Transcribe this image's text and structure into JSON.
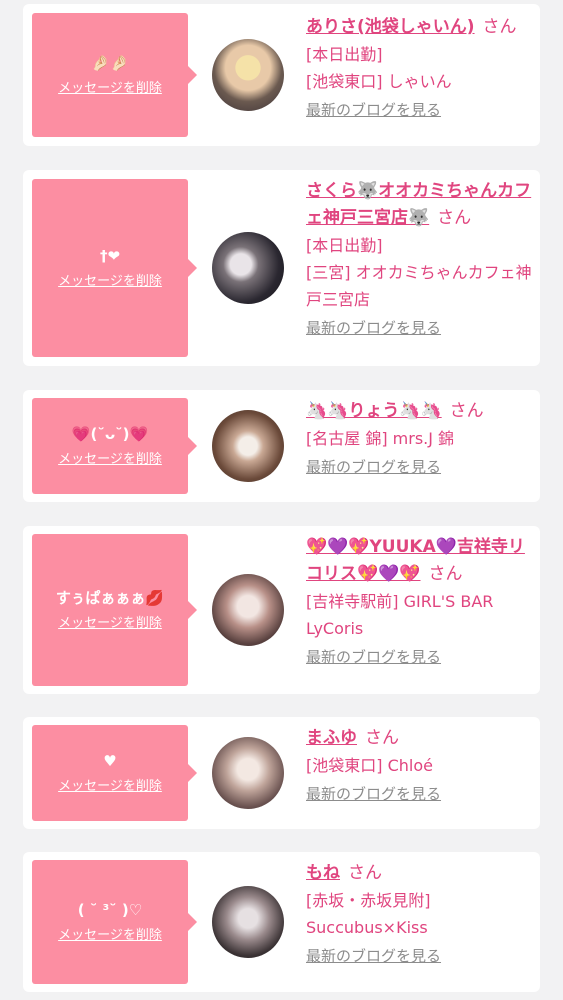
{
  "common": {
    "delete_label": "メッセージを削除",
    "blog_label": "最新のブログを見る",
    "san_label": "さん"
  },
  "cards": [
    {
      "message": "🤌🏻🤌🏻",
      "name": "ありさ(池袋しゃいん)",
      "detail1": "[本日出勤]",
      "detail2": "[池袋東口] しゃいん"
    },
    {
      "message": "†❤",
      "name": "さくら🐺オオカミちゃんカフェ神戸三宮店🐺",
      "detail1": "[本日出勤]",
      "detail2": "[三宮] オオカミちゃんカフェ神戸三宮店"
    },
    {
      "message": "💗(˘ᴗ˘)💗",
      "name": "🦄🦄りょう🦄🦄",
      "detail1": "[名古屋 錦] mrs.J 錦"
    },
    {
      "message": "すぅぱぁぁぁ💋",
      "name": "💖💜💖YUUKA💜吉祥寺リコリス💖💜💖",
      "detail1": "[吉祥寺駅前] GIRL'S BAR LyCoris"
    },
    {
      "message": "♥",
      "name": "まふゆ",
      "detail1": "[池袋東口] Chloé"
    },
    {
      "message": "( ˘ ³˘ )♡",
      "name": "もね",
      "detail1": "[赤坂・赤坂見附] Succubus×Kiss"
    }
  ],
  "colors": {
    "accent": "#e0457f",
    "bubble": "#fc8ea2",
    "muted": "#8c8c8c",
    "background": "#f2f2f3"
  }
}
